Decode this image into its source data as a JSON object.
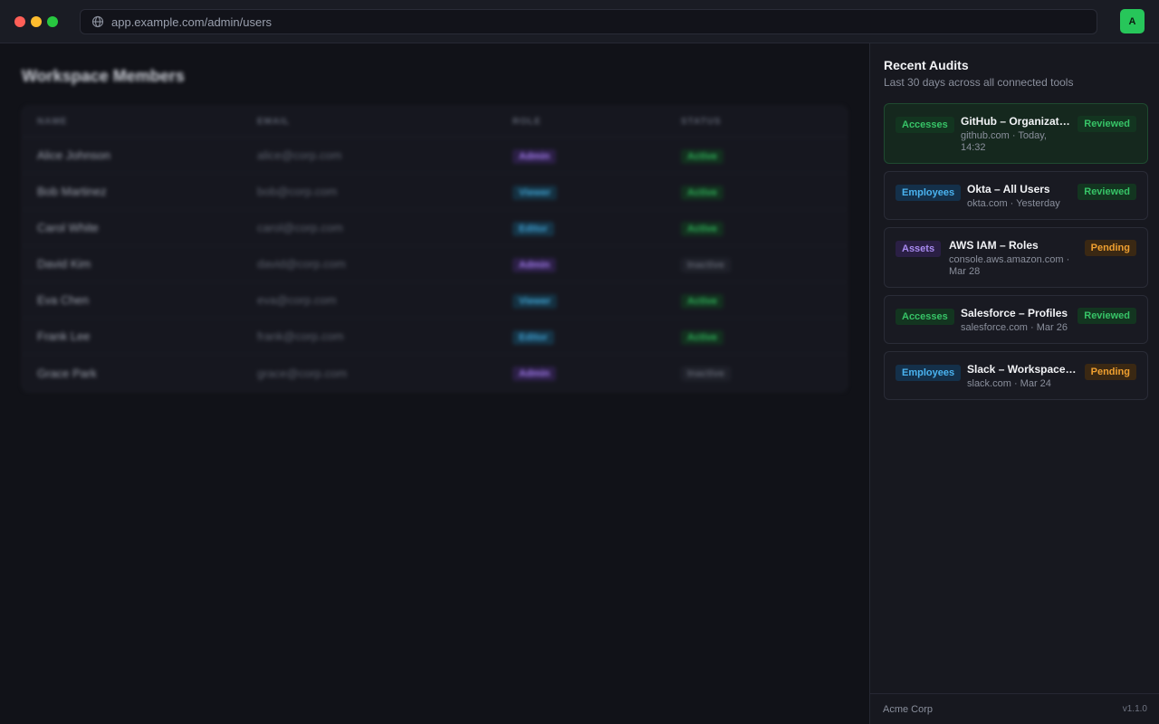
{
  "chrome": {
    "url": "app.example.com/admin/users",
    "avatar_initial": "A",
    "colors": {
      "close": "#ff5f57",
      "minimize": "#febc2e",
      "zoom": "#28c840",
      "avatar": "#27c65a"
    }
  },
  "main": {
    "title": "Workspace Members",
    "columns": [
      "NAME",
      "EMAIL",
      "ROLE",
      "STATUS"
    ],
    "rows": [
      {
        "name": "Alice Johnson",
        "email": "alice@corp.com",
        "role": "Admin",
        "status": "Active"
      },
      {
        "name": "Bob Martinez",
        "email": "bob@corp.com",
        "role": "Viewer",
        "status": "Active"
      },
      {
        "name": "Carol White",
        "email": "carol@corp.com",
        "role": "Editor",
        "status": "Active"
      },
      {
        "name": "David Kim",
        "email": "david@corp.com",
        "role": "Admin",
        "status": "Inactive"
      },
      {
        "name": "Eva Chen",
        "email": "eva@corp.com",
        "role": "Viewer",
        "status": "Active"
      },
      {
        "name": "Frank Lee",
        "email": "frank@corp.com",
        "role": "Editor",
        "status": "Active"
      },
      {
        "name": "Grace Park",
        "email": "grace@corp.com",
        "role": "Admin",
        "status": "Inactive"
      }
    ]
  },
  "panel": {
    "title": "Recent Audits",
    "subtitle": "Last 30 days across all connected tools",
    "audits": [
      {
        "category": "Accesses",
        "title": "GitHub – Organization Members",
        "meta": "github.com · Today, 14:32",
        "status": "Reviewed",
        "selected": true
      },
      {
        "category": "Employees",
        "title": "Okta – All Users",
        "meta": "okta.com · Yesterday",
        "status": "Reviewed",
        "selected": false
      },
      {
        "category": "Assets",
        "title": "AWS IAM – Roles",
        "meta": "console.aws.amazon.com · Mar 28",
        "status": "Pending",
        "selected": false
      },
      {
        "category": "Accesses",
        "title": "Salesforce – Profiles",
        "meta": "salesforce.com · Mar 26",
        "status": "Reviewed",
        "selected": false
      },
      {
        "category": "Employees",
        "title": "Slack – Workspace Members",
        "meta": "slack.com · Mar 24",
        "status": "Pending",
        "selected": false
      }
    ],
    "footer": {
      "org": "Acme Corp",
      "version": "v1.1.0"
    }
  }
}
